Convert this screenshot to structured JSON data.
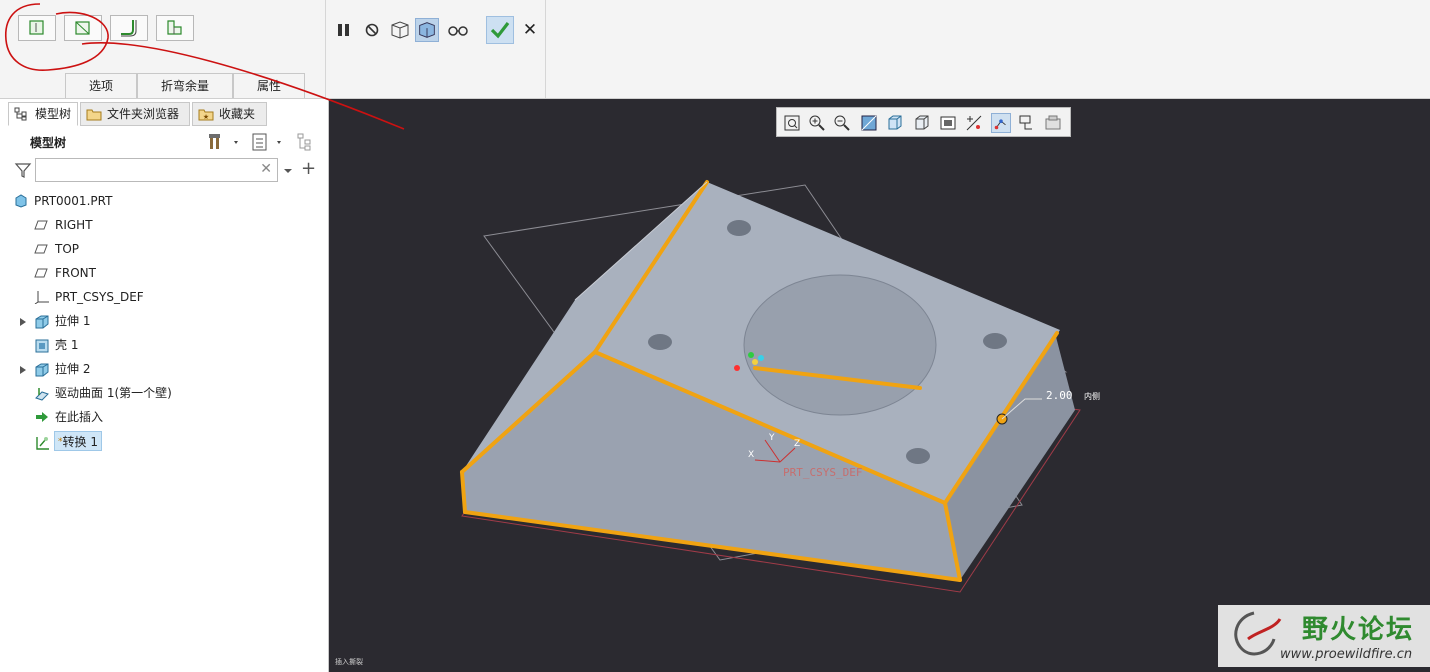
{
  "ribbon": {
    "left_buttons": [
      "flat-wall-icon",
      "flange-wall-icon",
      "bend-wall-icon",
      "unbend-wall-icon"
    ],
    "subtabs": [
      "选项",
      "折弯余量",
      "属性"
    ],
    "controls": {
      "pause_icon": "pause-icon",
      "stop_icon": "no-preview-icon",
      "preview_icon": "preview-icon",
      "verify_icon": "verify-icon",
      "glasses_icon": "glasses-icon",
      "ok_icon": "check-icon",
      "cancel_label": "✕"
    }
  },
  "panel": {
    "tabs": [
      "模型树",
      "文件夹浏览器",
      "收藏夹"
    ],
    "title": "模型树",
    "search_placeholder": "",
    "tree": [
      {
        "label": "PRT0001.PRT",
        "icon": "part-icon"
      },
      {
        "label": "RIGHT",
        "icon": "datum-plane-icon"
      },
      {
        "label": "TOP",
        "icon": "datum-plane-icon"
      },
      {
        "label": "FRONT",
        "icon": "datum-plane-icon"
      },
      {
        "label": "PRT_CSYS_DEF",
        "icon": "csys-icon"
      },
      {
        "label": "拉伸 1",
        "icon": "extrude-icon"
      },
      {
        "label": "壳 1",
        "icon": "shell-icon"
      },
      {
        "label": "拉伸 2",
        "icon": "extrude-icon"
      },
      {
        "label": "驱动曲面 1(第一个壁)",
        "icon": "driving-surface-icon"
      },
      {
        "label": "在此插入",
        "icon": "insert-here-icon"
      },
      {
        "label": "转换 1",
        "icon": "convert-icon"
      }
    ]
  },
  "viewport": {
    "dimension_value": "2.00",
    "dimension_suffix": "内侧",
    "csys_label": "PRT_CSYS_DEF",
    "axis_x": "X",
    "axis_y": "Y",
    "axis_z": "Z",
    "status_text": "插入撕裂"
  },
  "watermark": {
    "title": "野火论坛",
    "url": "www.proewildfire.cn"
  },
  "colors": {
    "viewport_bg": "#2b2a30",
    "model_face": "#a7afbc",
    "edge_highlight": "#f0a312",
    "annotation_red": "#cc1111",
    "ok_green": "#2f9a3a"
  }
}
